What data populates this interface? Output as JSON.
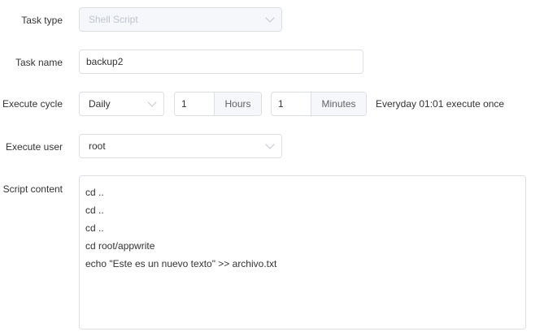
{
  "labels": {
    "task_type": "Task type",
    "task_name": "Task name",
    "execute_cycle": "Execute cycle",
    "execute_user": "Execute user",
    "script_content": "Script content"
  },
  "task_type": {
    "value": "Shell Script"
  },
  "task_name": {
    "value": "backup2"
  },
  "cycle": {
    "period": "Daily",
    "hours": "1",
    "hours_unit": "Hours",
    "minutes": "1",
    "minutes_unit": "Minutes",
    "summary": "Everyday 01:01 execute once"
  },
  "execute_user": {
    "value": "root"
  },
  "script": {
    "lines": [
      "cd ..",
      "cd ..",
      "cd ..",
      "cd root/appwrite",
      "echo \"Este es un nuevo texto\" >> archivo.txt"
    ]
  }
}
